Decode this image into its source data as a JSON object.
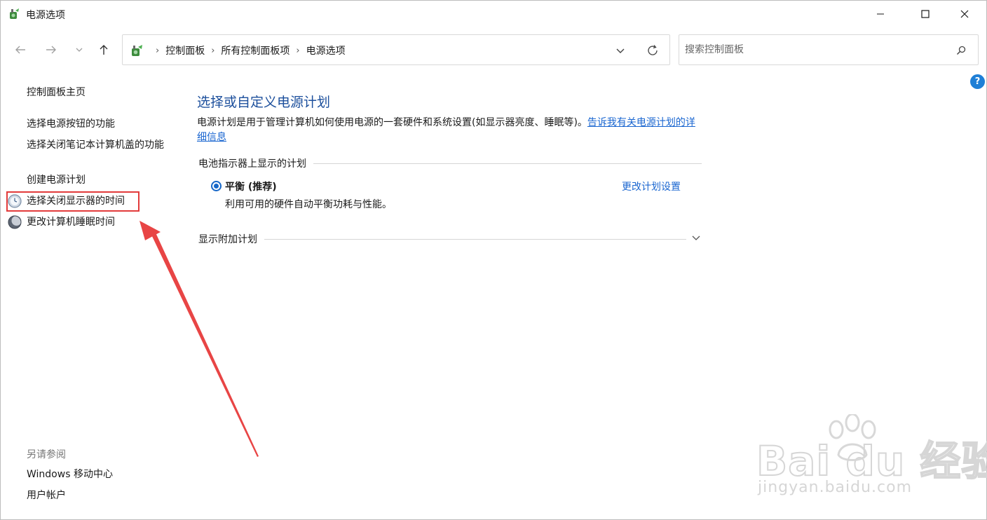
{
  "window": {
    "title": "电源选项",
    "minimize_label": "—",
    "maximize_label": "☐",
    "close_label": "✕"
  },
  "navbar": {
    "breadcrumbs": [
      "控制面板",
      "所有控制面板项",
      "电源选项"
    ],
    "search_placeholder": "搜索控制面板"
  },
  "sidebar": {
    "home_link": "控制面板主页",
    "links": [
      "选择电源按钮的功能",
      "选择关闭笔记本计算机盖的功能",
      "创建电源计划",
      "选择关闭显示器的时间",
      "更改计算机睡眠时间"
    ],
    "see_also_heading": "另请参阅",
    "see_also_links": [
      "Windows 移动中心",
      "用户帐户"
    ]
  },
  "main": {
    "title": "选择或自定义电源计划",
    "description": "电源计划是用于管理计算机如何使用电源的一套硬件和系统设置(如显示器亮度、睡眠等)。",
    "description_link": "告诉我有关电源计划的详细信息",
    "battery_section_heading": "电池指示器上显示的计划",
    "plan": {
      "name": "平衡 (推荐)",
      "description": "利用可用的硬件自动平衡功耗与性能。",
      "change_link": "更改计划设置",
      "selected": true
    },
    "additional_plans_heading": "显示附加计划"
  },
  "watermark": {
    "logo_text": "Bai du 经验",
    "url_text": "jingyan.baidu.com"
  },
  "colors": {
    "link": "#1a66d0",
    "title": "#1c4f9c",
    "annotation": "#e23b3b"
  }
}
